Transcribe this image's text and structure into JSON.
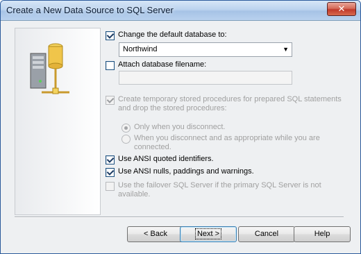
{
  "window": {
    "title": "Create a New Data Source to SQL Server",
    "close_symbol": "✕"
  },
  "options": {
    "change_default_db": {
      "label": "Change the default database to:",
      "checked": true
    },
    "database_combo": {
      "value": "Northwind",
      "arrow_icon": "chevron-down-icon"
    },
    "attach_db_filename": {
      "label": "Attach database filename:",
      "checked": false,
      "value": ""
    },
    "create_temp_procs": {
      "label": "Create temporary stored procedures for prepared SQL statements and drop the stored procedures:",
      "checked": true,
      "enabled": false
    },
    "radio_only_disconnect": {
      "label": "Only when you disconnect.",
      "selected": true,
      "enabled": false
    },
    "radio_disconnect_and_appropriate": {
      "label": "When you disconnect and as appropriate while you are connected.",
      "selected": false,
      "enabled": false
    },
    "ansi_quoted_identifiers": {
      "label": "Use ANSI quoted identifiers.",
      "checked": true
    },
    "ansi_nulls": {
      "label": "Use ANSI nulls, paddings and warnings.",
      "checked": true
    },
    "failover": {
      "label": "Use the failover SQL Server if the primary SQL Server is not available.",
      "checked": false,
      "enabled": false
    }
  },
  "buttons": {
    "back": "< Back",
    "next": "Next >",
    "cancel": "Cancel",
    "help": "Help"
  },
  "illustration": {
    "icon": "database-server-icon"
  }
}
